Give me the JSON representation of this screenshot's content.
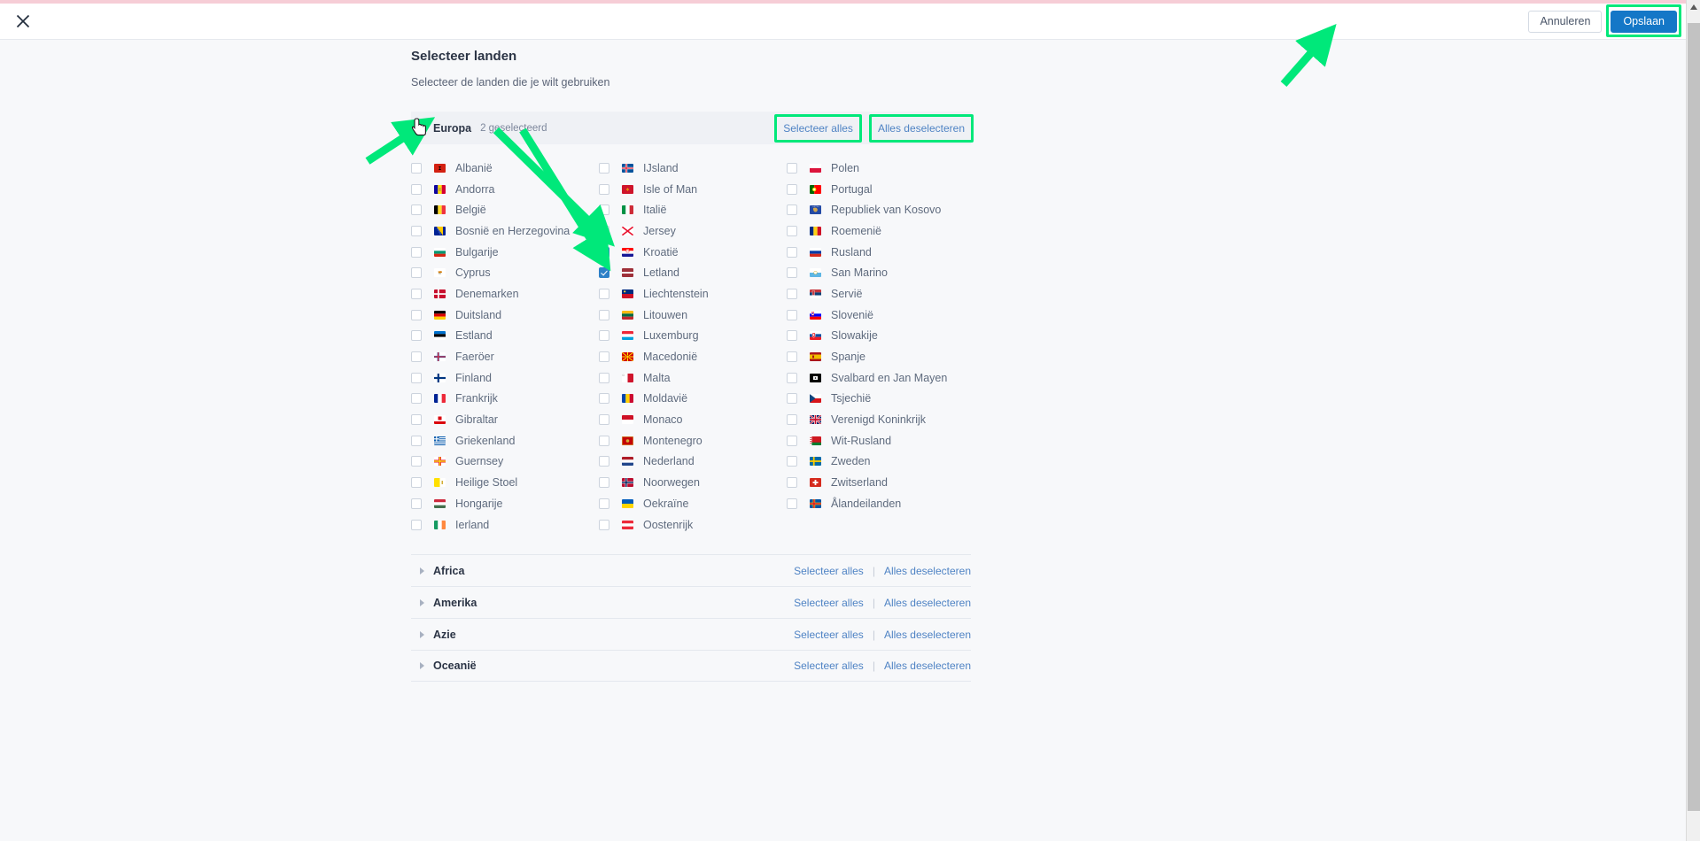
{
  "topbar": {
    "close_icon": "close-icon",
    "cancel_label": "Annuleren",
    "save_label": "Opslaan"
  },
  "page": {
    "title": "Selecteer landen",
    "subtitle": "Selecteer de landen die je wilt gebruiken"
  },
  "labels": {
    "select_all": "Selecteer alles",
    "deselect_all": "Alles deselecteren",
    "separator": "|"
  },
  "europe": {
    "name": "Europa",
    "count_label": "2 geselecteerd",
    "expanded": true,
    "countries": [
      {
        "name": "Albanië",
        "checked": false,
        "flag": "al"
      },
      {
        "name": "Andorra",
        "checked": false,
        "flag": "ad"
      },
      {
        "name": "België",
        "checked": false,
        "flag": "be"
      },
      {
        "name": "Bosnië en Herzegovina",
        "checked": false,
        "flag": "ba"
      },
      {
        "name": "Bulgarije",
        "checked": false,
        "flag": "bg"
      },
      {
        "name": "Cyprus",
        "checked": false,
        "flag": "cy"
      },
      {
        "name": "Denemarken",
        "checked": false,
        "flag": "dk"
      },
      {
        "name": "Duitsland",
        "checked": false,
        "flag": "de"
      },
      {
        "name": "Estland",
        "checked": false,
        "flag": "ee"
      },
      {
        "name": "Faeröer",
        "checked": false,
        "flag": "fo"
      },
      {
        "name": "Finland",
        "checked": false,
        "flag": "fi"
      },
      {
        "name": "Frankrijk",
        "checked": false,
        "flag": "fr"
      },
      {
        "name": "Gibraltar",
        "checked": false,
        "flag": "gi"
      },
      {
        "name": "Griekenland",
        "checked": false,
        "flag": "gr"
      },
      {
        "name": "Guernsey",
        "checked": false,
        "flag": "gg"
      },
      {
        "name": "Heilige Stoel",
        "checked": false,
        "flag": "va"
      },
      {
        "name": "Hongarije",
        "checked": false,
        "flag": "hu"
      },
      {
        "name": "Ierland",
        "checked": false,
        "flag": "ie"
      },
      {
        "name": "IJsland",
        "checked": false,
        "flag": "is"
      },
      {
        "name": "Isle of Man",
        "checked": false,
        "flag": "im"
      },
      {
        "name": "Italië",
        "checked": false,
        "flag": "it"
      },
      {
        "name": "Jersey",
        "checked": false,
        "flag": "je"
      },
      {
        "name": "Kroatië",
        "checked": true,
        "flag": "hr"
      },
      {
        "name": "Letland",
        "checked": true,
        "flag": "lv"
      },
      {
        "name": "Liechtenstein",
        "checked": false,
        "flag": "li"
      },
      {
        "name": "Litouwen",
        "checked": false,
        "flag": "lt"
      },
      {
        "name": "Luxemburg",
        "checked": false,
        "flag": "lu"
      },
      {
        "name": "Macedonië",
        "checked": false,
        "flag": "mk"
      },
      {
        "name": "Malta",
        "checked": false,
        "flag": "mt"
      },
      {
        "name": "Moldavië",
        "checked": false,
        "flag": "md"
      },
      {
        "name": "Monaco",
        "checked": false,
        "flag": "mc"
      },
      {
        "name": "Montenegro",
        "checked": false,
        "flag": "me"
      },
      {
        "name": "Nederland",
        "checked": false,
        "flag": "nl"
      },
      {
        "name": "Noorwegen",
        "checked": false,
        "flag": "no"
      },
      {
        "name": "Oekraïne",
        "checked": false,
        "flag": "ua"
      },
      {
        "name": "Oostenrijk",
        "checked": false,
        "flag": "at"
      },
      {
        "name": "Polen",
        "checked": false,
        "flag": "pl"
      },
      {
        "name": "Portugal",
        "checked": false,
        "flag": "pt"
      },
      {
        "name": "Republiek van Kosovo",
        "checked": false,
        "flag": "xk"
      },
      {
        "name": "Roemenië",
        "checked": false,
        "flag": "ro"
      },
      {
        "name": "Rusland",
        "checked": false,
        "flag": "ru"
      },
      {
        "name": "San Marino",
        "checked": false,
        "flag": "sm"
      },
      {
        "name": "Servië",
        "checked": false,
        "flag": "rs"
      },
      {
        "name": "Slovenië",
        "checked": false,
        "flag": "si"
      },
      {
        "name": "Slowakije",
        "checked": false,
        "flag": "sk"
      },
      {
        "name": "Spanje",
        "checked": false,
        "flag": "es"
      },
      {
        "name": "Svalbard en Jan Mayen",
        "checked": false,
        "flag": "sj"
      },
      {
        "name": "Tsjechië",
        "checked": false,
        "flag": "cz"
      },
      {
        "name": "Verenigd Koninkrijk",
        "checked": false,
        "flag": "gb"
      },
      {
        "name": "Wit-Rusland",
        "checked": false,
        "flag": "by"
      },
      {
        "name": "Zweden",
        "checked": false,
        "flag": "se"
      },
      {
        "name": "Zwitserland",
        "checked": false,
        "flag": "ch"
      },
      {
        "name": "Ålandeilanden",
        "checked": false,
        "flag": "ax"
      }
    ]
  },
  "collapsed_continents": [
    {
      "name": "Africa"
    },
    {
      "name": "Amerika"
    },
    {
      "name": "Azie"
    },
    {
      "name": "Oceanië"
    }
  ],
  "colors": {
    "accent_blue": "#1477c7",
    "checkbox_blue": "#2d80c7",
    "link_blue": "#4f83c4",
    "highlight_green": "#00e87a",
    "top_strip_pink": "#f6cdd6",
    "header_bg": "#eff1f5"
  }
}
